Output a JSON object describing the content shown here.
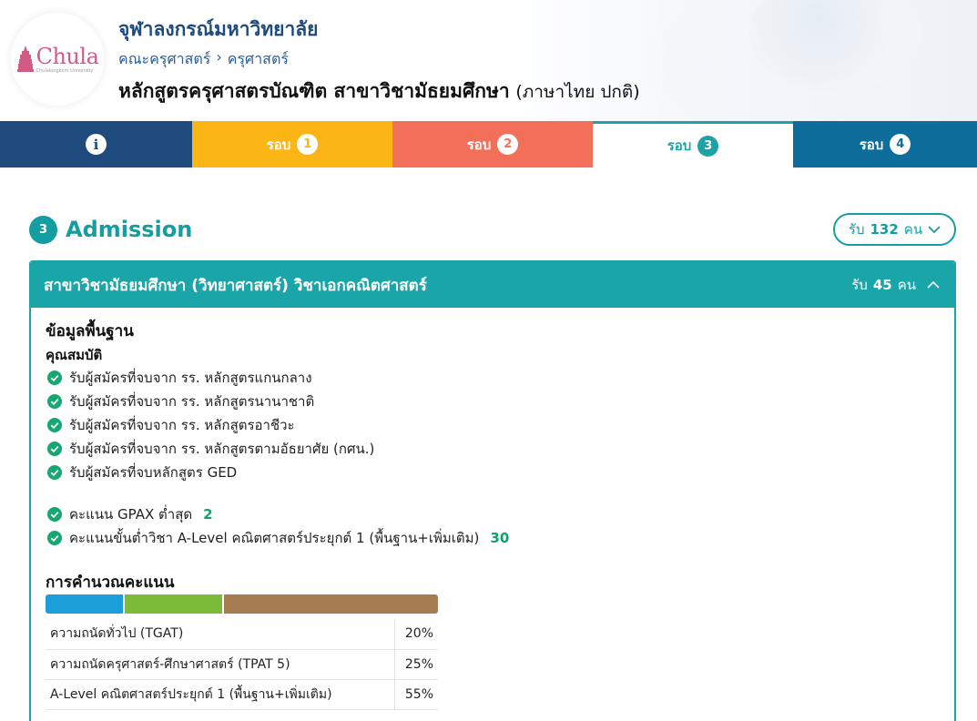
{
  "header": {
    "logo_word": "Chula",
    "logo_sub": "Chulalongkorn University",
    "university": "จุฬาลงกรณ์มหาวิทยาลัย",
    "breadcrumb": [
      "คณะครุศาสตร์",
      "ครุศาสตร์"
    ],
    "breadcrumb_sep": "›",
    "program_title": "หลักสูตรครุศาสตรบัณฑิต สาขาวิชามัธยมศึกษา",
    "program_note": "(ภาษาไทย ปกติ)"
  },
  "tabs": [
    {
      "label": "",
      "num": "i",
      "color": "#1e4a7d"
    },
    {
      "label": "รอบ",
      "num": "1",
      "color": "#fbb515"
    },
    {
      "label": "รอบ",
      "num": "2",
      "color": "#f26f5a"
    },
    {
      "label": "รอบ",
      "num": "3",
      "color": "#1fa2a6",
      "active": true
    },
    {
      "label": "รอบ",
      "num": "4",
      "color": "#0f6d9b"
    }
  ],
  "section": {
    "badge": "3",
    "title": "Admission",
    "quota_prefix": "รับ",
    "quota_num": "132",
    "quota_unit": "คน"
  },
  "card": {
    "title": "สาขาวิชามัธยมศึกษา (วิทยาศาสตร์) วิชาเอกคณิตศาสตร์",
    "quota_prefix": "รับ",
    "quota_num": "45",
    "quota_unit": "คน",
    "basic_title": "ข้อมูลพื้นฐาน",
    "qual_title": "คุณสมบัติ",
    "requirements": [
      "รับผู้สมัครที่จบจาก รร. หลักสูตรแกนกลาง",
      "รับผู้สมัครที่จบจาก รร. หลักสูตรนานาชาติ",
      "รับผู้สมัครที่จบจาก รร. หลักสูตรอาชีวะ",
      "รับผู้สมัครที่จบจาก รร. หลักสูตรตามอัธยาศัย (กศน.)",
      "รับผู้สมัครที่จบหลักสูตร GED"
    ],
    "score_reqs": [
      {
        "label": "คะแนน GPAX ต่ำสุด",
        "value": "2"
      },
      {
        "label": "คะแนนขั้นต่ำวิชา A-Level คณิตศาสตร์ประยุกต์ 1 (พื้นฐาน+เพิ่มเติม)",
        "value": "30"
      }
    ],
    "calc_title": "การคำนวณคะแนน",
    "weights": [
      {
        "subject": "ความถนัดทั่วไป (TGAT)",
        "percent": "20%",
        "value": 20,
        "color": "#1a9fd8"
      },
      {
        "subject": "ความถนัดครุศาสตร์-ศึกษาศาสตร์ (TPAT 5)",
        "percent": "25%",
        "value": 25,
        "color": "#7cba3a"
      },
      {
        "subject": "A-Level คณิตศาสตร์ประยุกต์ 1 (พื้นฐาน+เพิ่มเติม)",
        "percent": "55%",
        "value": 55,
        "color": "#a67c52"
      }
    ]
  }
}
